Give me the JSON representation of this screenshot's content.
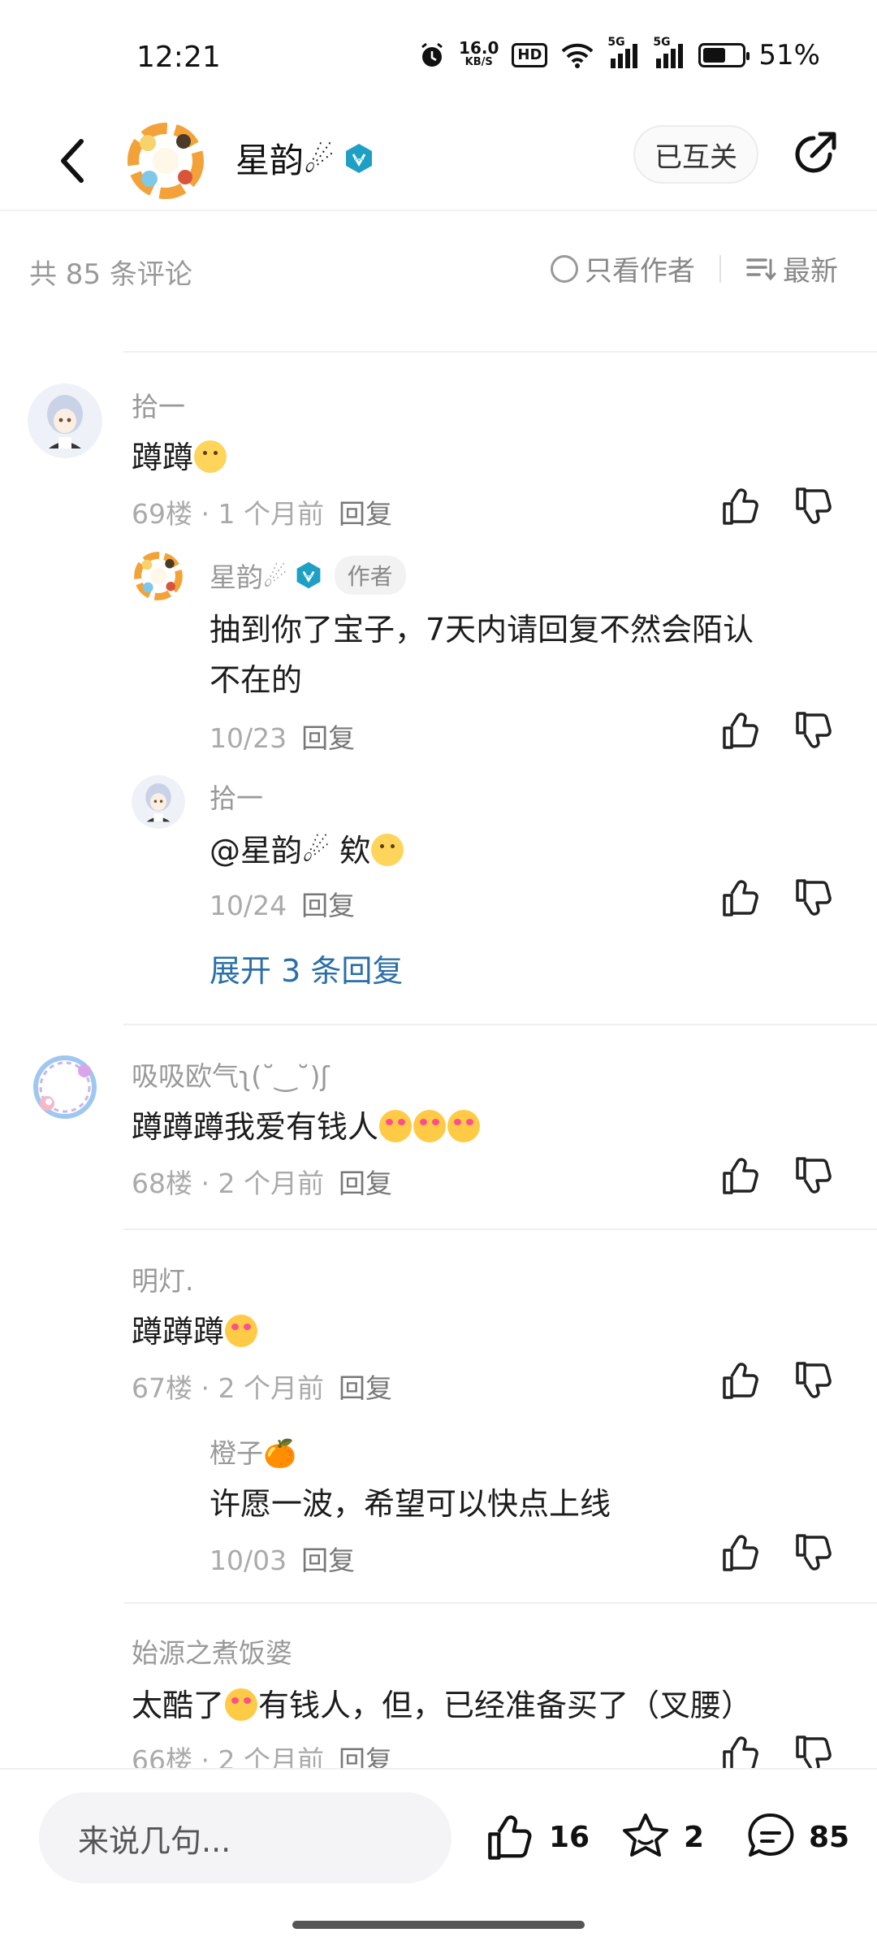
{
  "status_bar": {
    "time": "12:21",
    "net_speed_value": "16.0",
    "net_speed_unit": "KB/S",
    "hd_label": "HD",
    "signal_label_1": "5G",
    "signal_label_2": "5G",
    "battery_percent_text": "51%",
    "battery_level": 0.51
  },
  "header": {
    "username": "星韵☄",
    "follow_label": "已互关"
  },
  "comments_bar": {
    "count_text": "共 85 条评论",
    "author_only_label": "只看作者",
    "sort_label": "最新"
  },
  "comments": [
    {
      "user": "拾一",
      "text": "蹲蹲",
      "meta": "69楼 · 1 个月前",
      "reply_label": "回复",
      "replies": [
        {
          "user": "星韵☄",
          "author_tag": "作者",
          "text_line1": "抽到你了宝子，7天内请回复不然会陌认",
          "text_line2": "不在的",
          "meta": "10/23",
          "reply_label": "回复"
        },
        {
          "user": "拾一",
          "text": "@星韵☄  欸",
          "meta": "10/24",
          "reply_label": "回复"
        }
      ],
      "expand_label": "展开 3 条回复"
    },
    {
      "user": "吸吸欧气ʅ(˘‿˘)ʃ",
      "text": "蹲蹲蹲我爱有钱人",
      "meta": "68楼 · 2 个月前",
      "reply_label": "回复"
    },
    {
      "user": "明灯.",
      "text": "蹲蹲蹲",
      "meta": "67楼 · 2 个月前",
      "reply_label": "回复",
      "replies": [
        {
          "user": "橙子🍊",
          "text": "许愿一波，希望可以快点上线",
          "meta": "10/03",
          "reply_label": "回复"
        }
      ]
    },
    {
      "user": "始源之煮饭婆",
      "text_before": "太酷了",
      "text_after": "有钱人，但，已经准备买了（叉腰）",
      "meta": "66楼 · 2 个月前",
      "reply_label": "回复"
    }
  ],
  "bottom_bar": {
    "input_placeholder": "来说几句...",
    "like_count": "16",
    "favorite_count": "2",
    "comment_count": "85"
  },
  "colors": {
    "link_blue": "#2a6fa8",
    "muted_text": "#999999",
    "badge_teal": "#1e9fc4"
  },
  "icons": [
    "back-arrow-icon",
    "verified-badge-icon",
    "share-icon",
    "circle-icon",
    "sort-icon",
    "thumbs-up-icon",
    "thumbs-down-icon",
    "star-icon",
    "comment-icon"
  ]
}
